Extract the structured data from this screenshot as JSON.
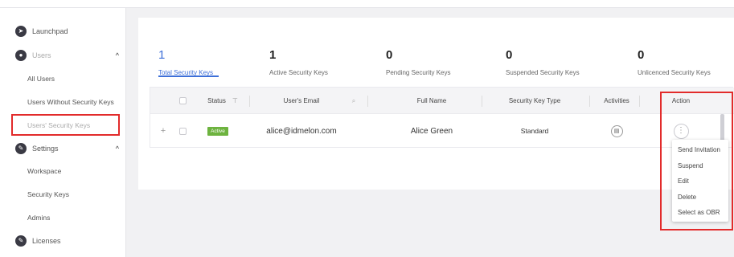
{
  "sidebar": {
    "launchpad": {
      "label": "Launchpad",
      "icon": "rocket-icon"
    },
    "users": {
      "label": "Users",
      "icon": "users-icon",
      "expanded": true,
      "items": [
        {
          "label": "All Users"
        },
        {
          "label": "Users Without Security Keys"
        },
        {
          "label": "Users' Security Keys",
          "selected": true
        }
      ]
    },
    "settings": {
      "label": "Settings",
      "icon": "settings-icon",
      "expanded": true,
      "items": [
        {
          "label": "Workspace"
        },
        {
          "label": "Security Keys"
        },
        {
          "label": "Admins"
        }
      ]
    },
    "licenses": {
      "label": "Licenses",
      "icon": "licenses-icon"
    }
  },
  "stats": [
    {
      "value": "1",
      "label": "Total Security Keys",
      "active": true
    },
    {
      "value": "1",
      "label": "Active Security Keys"
    },
    {
      "value": "0",
      "label": "Pending Security Keys"
    },
    {
      "value": "0",
      "label": "Suspended Security Keys"
    },
    {
      "value": "0",
      "label": "Unlicenced Security Keys"
    }
  ],
  "table": {
    "columns": {
      "status": "Status",
      "email": "User's Email",
      "full_name": "Full Name",
      "key_type": "Security Key Type",
      "activities": "Activities",
      "action": "Action"
    },
    "rows": [
      {
        "status": "Active",
        "email": "alice@idmelon.com",
        "full_name": "Alice Green",
        "key_type": "Standard"
      }
    ]
  },
  "action_menu": {
    "items": [
      {
        "label": "Send Invitation"
      },
      {
        "label": "Suspend"
      },
      {
        "label": "Edit"
      },
      {
        "label": "Delete"
      },
      {
        "label": "Select as OBR"
      }
    ]
  },
  "colors": {
    "accent": "#3d6fd8",
    "status_active": "#6db33f",
    "highlight": "#e22b2b"
  }
}
